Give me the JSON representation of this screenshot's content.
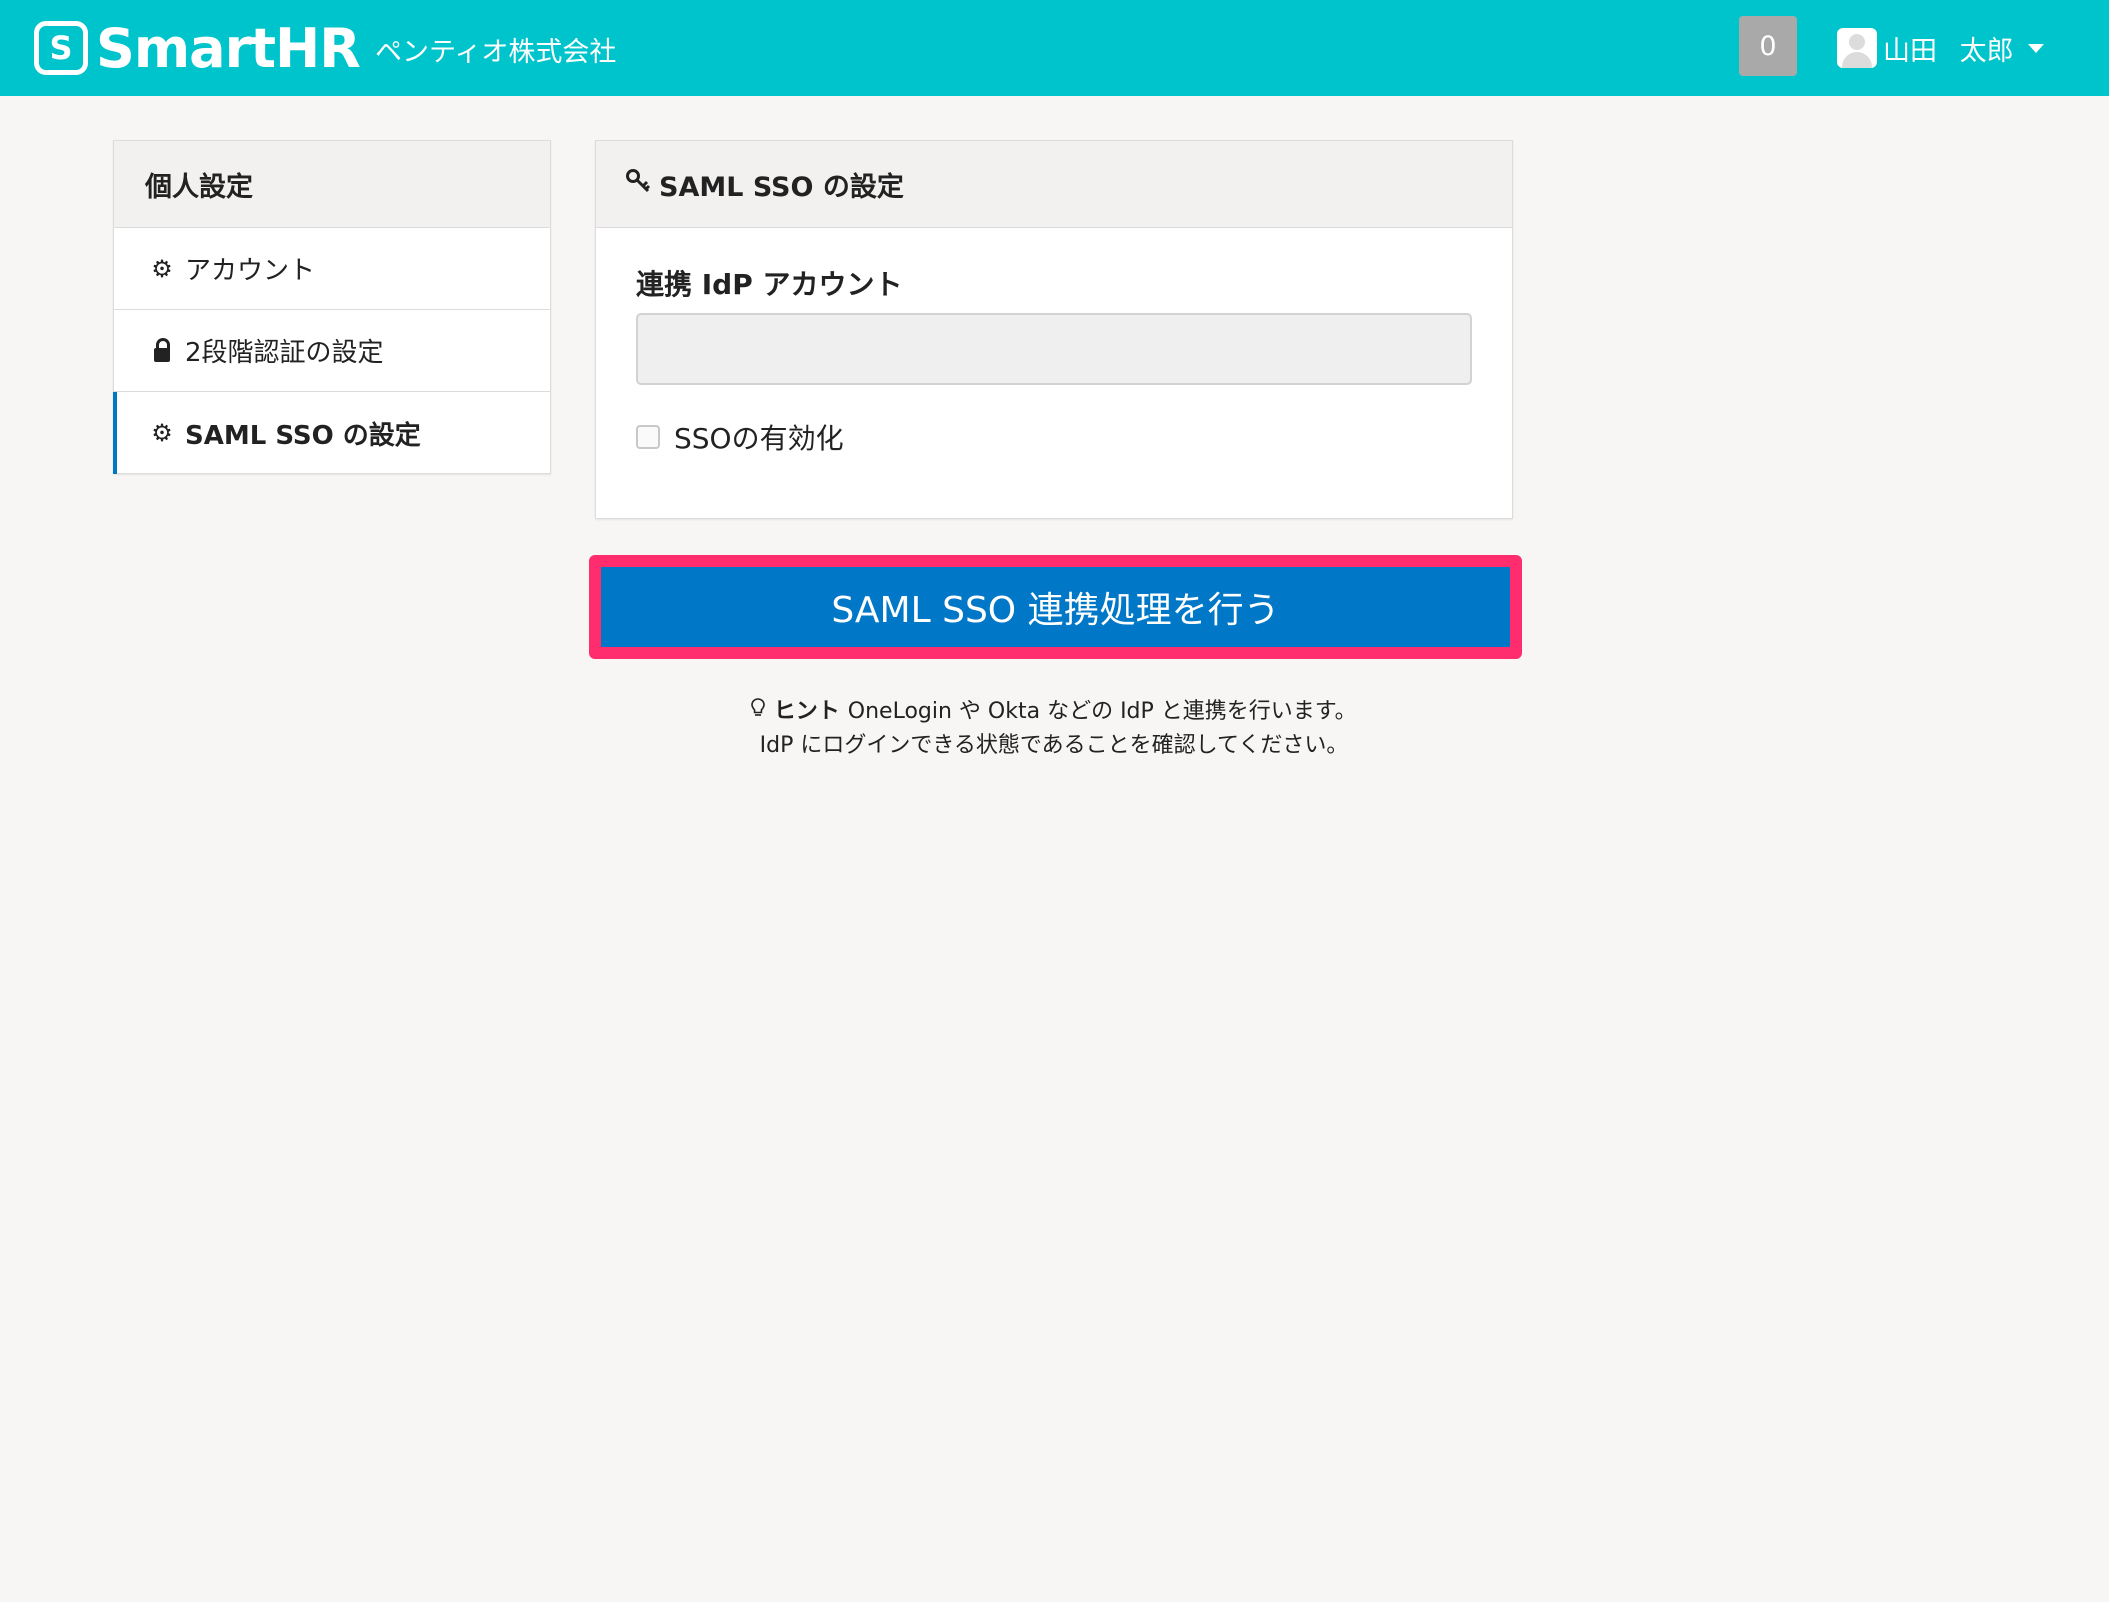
{
  "header": {
    "logo_mark": "S",
    "logo_text": "SmartHR",
    "company": "ペンティオ株式会社",
    "notification_count": "0",
    "user_name": "山田 太郎",
    "bg_color": "#00c4cc"
  },
  "sidebar": {
    "title": "個人設定",
    "items": [
      {
        "label": "アカウント",
        "icon": "gear-icon",
        "glyph": "⚙",
        "active": false
      },
      {
        "label": "2段階認証の設定",
        "icon": "lock-icon",
        "active": false
      },
      {
        "label": "SAML SSO の設定",
        "icon": "gear-icon",
        "glyph": "⚙",
        "active": true
      }
    ]
  },
  "panel": {
    "title": "SAML SSO の設定",
    "title_icon": "key-icon",
    "field_label": "連携 IdP アカウント",
    "field_value": "",
    "checkbox_label": "SSOの有効化",
    "checkbox_checked": false
  },
  "action": {
    "label": "SAML SSO 連携処理を行う",
    "color": "#0077c7",
    "highlight_color": "#ff2d6d"
  },
  "hint": {
    "icon": "lightbulb-icon",
    "title": "ヒント",
    "line1": "OneLogin や Okta などの IdP と連携を行います。",
    "line2": "IdP にログインできる状態であることを確認してください。"
  }
}
